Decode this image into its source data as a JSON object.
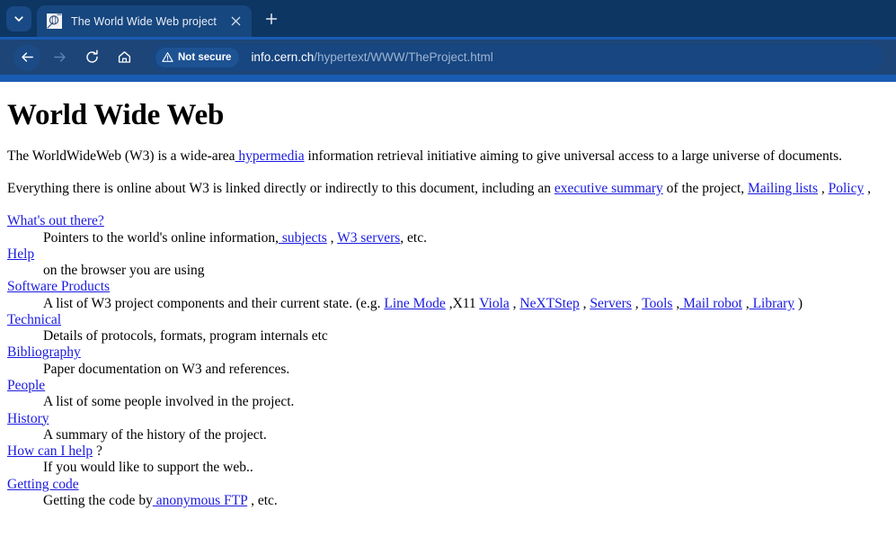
{
  "browser": {
    "tab_search_icon": "chevron-down-icon",
    "tab": {
      "favicon": "cern-www-favicon",
      "title": "The World Wide Web project",
      "close_icon": "close-icon"
    },
    "new_tab_icon": "plus-icon",
    "toolbar": {
      "back_icon": "back-arrow-icon",
      "forward_icon": "forward-arrow-icon",
      "reload_icon": "reload-icon",
      "home_icon": "home-icon",
      "security_icon": "warning-triangle-icon",
      "security_label": "Not secure",
      "url_host": "info.cern.ch",
      "url_path": "/hypertext/WWW/TheProject.html",
      "url_full": "info.cern.ch/hypertext/WWW/TheProject.html"
    },
    "colors": {
      "tabstrip_bg": "#0d3663",
      "active_tab_bg": "#17477f",
      "toolbar_bg": "#1d4578",
      "accent_line": "#1a5cb4",
      "omnibox_bg": "#174680",
      "chip_bg": "#1d5293"
    }
  },
  "page": {
    "title": "World Wide Web",
    "paragraph1": [
      {
        "type": "text",
        "value": "The WorldWideWeb (W3) is a wide-area"
      },
      {
        "type": "link",
        "value": " hypermedia"
      },
      {
        "type": "text",
        "value": " information retrieval initiative aiming to give universal access to a large universe of documents."
      }
    ],
    "paragraph2": [
      {
        "type": "text",
        "value": "Everything there is online about W3 is linked directly or indirectly to this document, including an "
      },
      {
        "type": "link",
        "value": "executive summary"
      },
      {
        "type": "text",
        "value": " of the project, "
      },
      {
        "type": "link",
        "value": "Mailing lists"
      },
      {
        "type": "text",
        "value": " , "
      },
      {
        "type": "link",
        "value": "Policy"
      },
      {
        "type": "text",
        "value": " ,"
      }
    ],
    "entries": [
      {
        "term": [
          {
            "type": "link",
            "value": "What's out there?"
          }
        ],
        "desc": [
          {
            "type": "text",
            "value": "Pointers to the world's online information,"
          },
          {
            "type": "link",
            "value": " subjects"
          },
          {
            "type": "text",
            "value": " , "
          },
          {
            "type": "link",
            "value": "W3 servers"
          },
          {
            "type": "text",
            "value": ", etc."
          }
        ]
      },
      {
        "term": [
          {
            "type": "link",
            "value": "Help"
          }
        ],
        "desc": [
          {
            "type": "text",
            "value": "on the browser you are using"
          }
        ]
      },
      {
        "term": [
          {
            "type": "link",
            "value": "Software Products"
          }
        ],
        "desc": [
          {
            "type": "text",
            "value": "A list of W3 project components and their current state. (e.g. "
          },
          {
            "type": "link",
            "value": "Line Mode"
          },
          {
            "type": "text",
            "value": " ,X11 "
          },
          {
            "type": "link",
            "value": "Viola"
          },
          {
            "type": "text",
            "value": " , "
          },
          {
            "type": "link",
            "value": "NeXTStep"
          },
          {
            "type": "text",
            "value": " , "
          },
          {
            "type": "link",
            "value": "Servers"
          },
          {
            "type": "text",
            "value": " , "
          },
          {
            "type": "link",
            "value": "Tools"
          },
          {
            "type": "text",
            "value": " ,"
          },
          {
            "type": "link",
            "value": " Mail robot"
          },
          {
            "type": "text",
            "value": " ,"
          },
          {
            "type": "link",
            "value": " Library"
          },
          {
            "type": "text",
            "value": " )"
          }
        ]
      },
      {
        "term": [
          {
            "type": "link",
            "value": "Technical"
          }
        ],
        "desc": [
          {
            "type": "text",
            "value": "Details of protocols, formats, program internals etc"
          }
        ]
      },
      {
        "term": [
          {
            "type": "link",
            "value": "Bibliography"
          }
        ],
        "desc": [
          {
            "type": "text",
            "value": "Paper documentation on W3 and references."
          }
        ]
      },
      {
        "term": [
          {
            "type": "link",
            "value": "People"
          }
        ],
        "desc": [
          {
            "type": "text",
            "value": "A list of some people involved in the project."
          }
        ]
      },
      {
        "term": [
          {
            "type": "link",
            "value": "History"
          }
        ],
        "desc": [
          {
            "type": "text",
            "value": "A summary of the history of the project."
          }
        ]
      },
      {
        "term": [
          {
            "type": "link",
            "value": "How can I help"
          },
          {
            "type": "text",
            "value": " ?"
          }
        ],
        "desc": [
          {
            "type": "text",
            "value": "If you would like to support the web.."
          }
        ]
      },
      {
        "term": [
          {
            "type": "link",
            "value": "Getting code"
          }
        ],
        "desc": [
          {
            "type": "text",
            "value": "Getting the code by"
          },
          {
            "type": "link",
            "value": " anonymous FTP"
          },
          {
            "type": "text",
            "value": " , etc."
          }
        ]
      }
    ]
  }
}
